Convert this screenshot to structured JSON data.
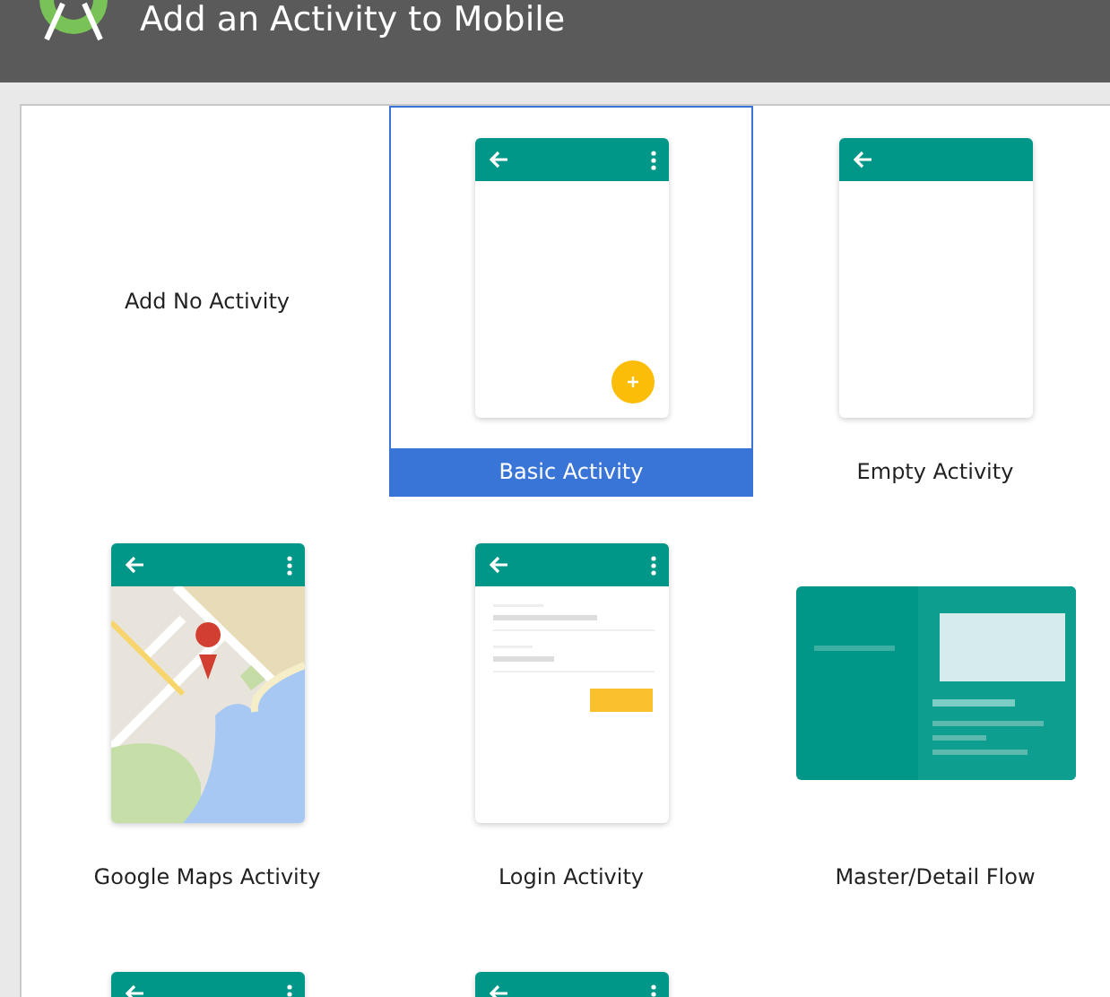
{
  "window": {
    "title": "Add an Activity to Mobile"
  },
  "templates": [
    {
      "kind": "none",
      "label": "Add No Activity",
      "selected": false
    },
    {
      "kind": "basic",
      "label": "Basic Activity",
      "selected": true,
      "overflow_menu": true
    },
    {
      "kind": "empty",
      "label": "Empty Activity",
      "selected": false,
      "overflow_menu": false
    },
    {
      "kind": "maps",
      "label": "Google Maps Activity",
      "selected": false,
      "overflow_menu": true
    },
    {
      "kind": "login",
      "label": "Login Activity",
      "selected": false,
      "overflow_menu": true
    },
    {
      "kind": "master",
      "label": "Master/Detail Flow",
      "selected": false
    },
    {
      "kind": "settings",
      "selected": false,
      "overflow_menu": true
    },
    {
      "kind": "empty",
      "selected": false,
      "overflow_menu": true
    }
  ]
}
